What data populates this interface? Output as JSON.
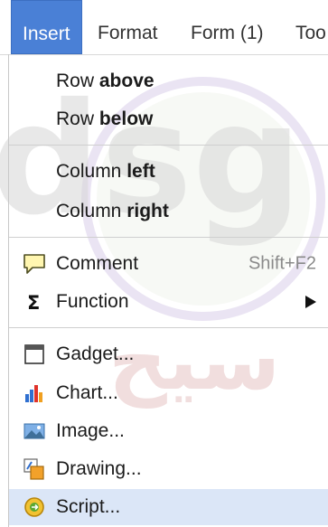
{
  "menubar": {
    "items": [
      {
        "label": "Insert",
        "active": true
      },
      {
        "label": "Format"
      },
      {
        "label": "Form (1)"
      },
      {
        "label": "Too"
      }
    ]
  },
  "menu": {
    "row_above": {
      "prefix": "Row ",
      "bold": "above"
    },
    "row_below": {
      "prefix": "Row ",
      "bold": "below"
    },
    "column_left": {
      "prefix": "Column ",
      "bold": "left"
    },
    "column_right": {
      "prefix": "Column ",
      "bold": "right"
    },
    "comment": {
      "label": "Comment",
      "shortcut": "Shift+F2",
      "icon": "comment-icon"
    },
    "function": {
      "label": "Function",
      "icon": "sigma-icon",
      "submenu": true
    },
    "gadget": {
      "label": "Gadget...",
      "icon": "gadget-icon"
    },
    "chart": {
      "label": "Chart...",
      "icon": "chart-icon"
    },
    "image": {
      "label": "Image...",
      "icon": "image-icon"
    },
    "drawing": {
      "label": "Drawing...",
      "icon": "drawing-icon"
    },
    "script": {
      "label": "Script...",
      "icon": "script-icon",
      "highlighted": true
    }
  },
  "colors": {
    "accent": "#4a80d6",
    "hover": "#dbe6f7"
  }
}
